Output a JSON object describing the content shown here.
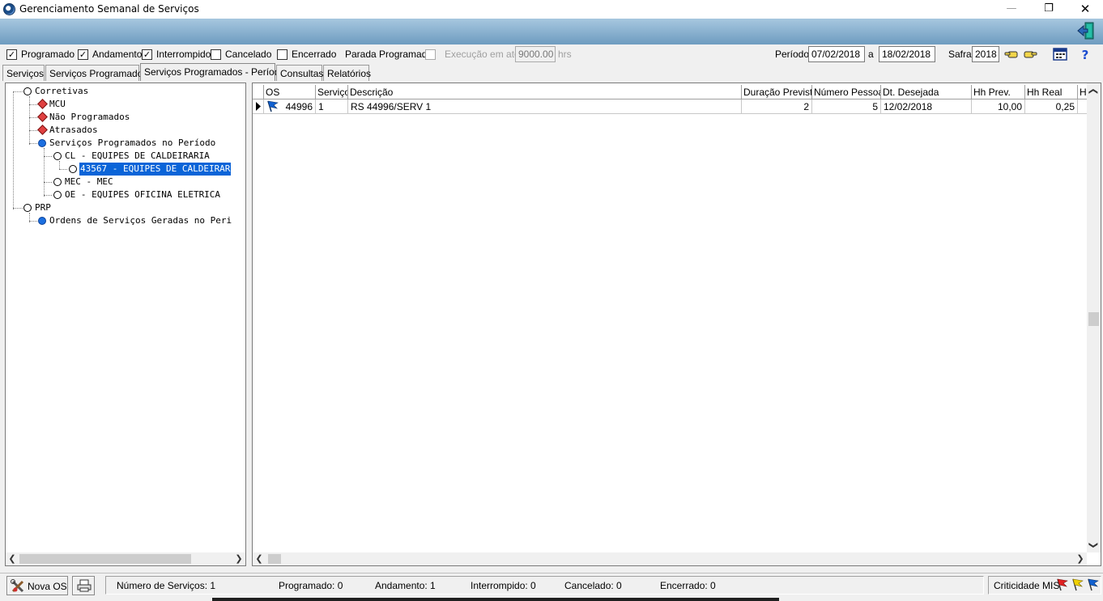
{
  "window": {
    "title": "Gerenciamento Semanal de Serviços",
    "min_icon": "—",
    "max_icon": "❐",
    "close_icon": "✕"
  },
  "filters": {
    "programado": {
      "label": "Programado",
      "checked": true
    },
    "andamento": {
      "label": "Andamento",
      "checked": true
    },
    "interrompido": {
      "label": "Interrompido",
      "checked": true
    },
    "cancelado": {
      "label": "Cancelado",
      "checked": false
    },
    "encerrado": {
      "label": "Encerrado",
      "checked": false
    },
    "parada_programada": {
      "label": "Parada Programada",
      "checked": false
    },
    "execucao_label": "Execução em até",
    "execucao_value": "9000.00",
    "execucao_unit": "hrs",
    "periodo_label": "Período",
    "periodo_inicio": "07/02/2018",
    "periodo_a": "a",
    "periodo_fim": "18/02/2018",
    "safra_label": "Safra",
    "safra_value": "2018",
    "check_mark": "✓"
  },
  "tabs": [
    {
      "label": "Serviços",
      "active": false
    },
    {
      "label": "Serviços Programados",
      "active": false
    },
    {
      "label": "Serviços Programados - Período",
      "active": true
    },
    {
      "label": "Consultas",
      "active": false
    },
    {
      "label": "Relatórios",
      "active": false
    }
  ],
  "tree": {
    "corretivas": "Corretivas",
    "mcu": "MCU",
    "nao_programados": "Não Programados",
    "atrasados": "Atrasados",
    "servicos_periodo": "Serviços Programados no Período",
    "cl": "CL  - EQUIPES DE CALDEIRARIA",
    "cl_child": "43567 - EQUIPES DE CALDEIRAR",
    "mec": "MEC - MEC",
    "oe": "OE  - EQUIPES OFICINA ELETRICA",
    "prp": "PRP",
    "ordens": "Ordens de Serviços Geradas no Peri"
  },
  "grid": {
    "headers": [
      "OS",
      "Serviço",
      "Descrição",
      "Duração Prevista",
      "Número Pessoas",
      "Dt. Desejada",
      "Hh Prev.",
      "Hh Real",
      "H"
    ],
    "rows": [
      {
        "os": "44996",
        "servico": "1",
        "descricao": "RS 44996/SERV 1",
        "duracao": "2",
        "pessoas": "5",
        "dt_desejada": "12/02/2018",
        "hh_prev": "10,00",
        "hh_real": "0,25"
      }
    ]
  },
  "statusbar": {
    "nova_os": "Nova OS",
    "numero_servicos": "Número de Serviços: 1",
    "programado": "Programado: 0",
    "andamento": "Andamento: 1",
    "interrompido": "Interrompido: 0",
    "cancelado": "Cancelado: 0",
    "encerrado": "Encerrado: 0",
    "criticidade": "Criticidade MIS"
  },
  "colors": {
    "selection": "#0a64d8",
    "flag_red": "#e02020",
    "flag_yellow": "#f0d000",
    "flag_blue": "#1060d0",
    "band_top": "#a7c7df",
    "band_bottom": "#6e9cc0"
  }
}
